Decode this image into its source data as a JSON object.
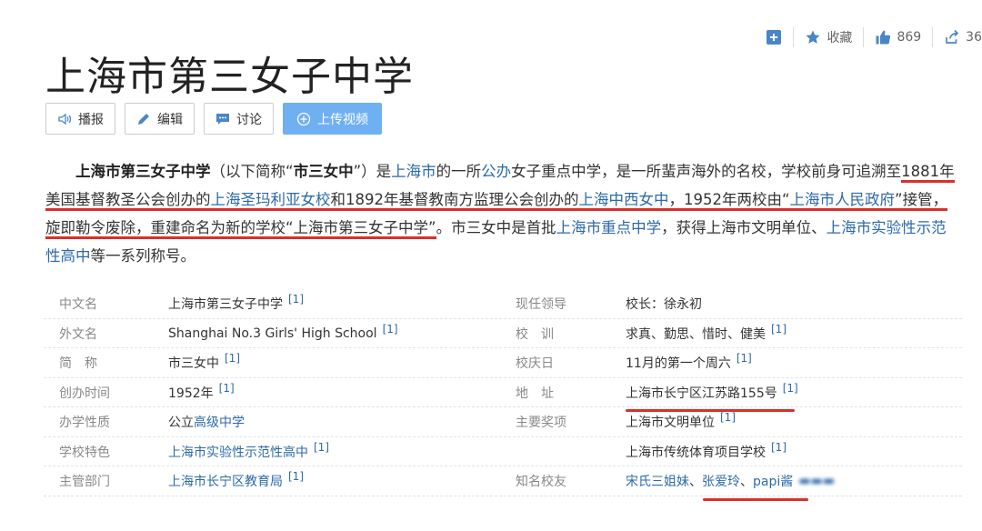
{
  "top_actions": {
    "add_icon": "plus-square-icon",
    "favorite_label": "收藏",
    "like_count": "869",
    "share_count": "36"
  },
  "title": "上海市第三女子中学",
  "toolbar": {
    "broadcast_label": "播报",
    "edit_label": "编辑",
    "discuss_label": "讨论",
    "upload_video_label": "上传视频"
  },
  "summary": {
    "bold_name": "上海市第三女子中学",
    "t1": "（以下简称“",
    "abbr": "市三女中",
    "t2": "”）是",
    "link_shanghai": "上海市",
    "t3": "的一所",
    "link_public": "公办",
    "t4": "女子重点中学，是一所蜚声海外的名校，学校前身可追溯至",
    "t5": "1881年美国基督教圣公会创办的",
    "link_school1": "上海圣玛利亚女校",
    "t6": "和1892年基督教南方监理公会创办的",
    "link_school2": "上海中西女中",
    "t7": "，1952年两校由“",
    "link_gov": "上海市人民政府",
    "t8": "”接管，旋即勒令废除，重建命名为新的学校“上海市第三女子中学”",
    "t9": "。市三女中是首批",
    "link_key": "上海市重点中学",
    "t10": "，获得上海市文明单位、",
    "link_exp": "上海市实验性示范性高中",
    "t11": "等一系列称号。"
  },
  "info_left": [
    {
      "label": "中文名",
      "value": "上海市第三女子中学",
      "link": false,
      "ref": "[1]"
    },
    {
      "label": "外文名",
      "value": "Shanghai No.3 Girls' High School",
      "link": false,
      "ref": "[1]"
    },
    {
      "label": "简　称",
      "value": "市三女中",
      "link": false,
      "ref": "[1]"
    },
    {
      "label": "创办时间",
      "value": "1952年",
      "link": false,
      "ref": "[1]"
    },
    {
      "label": "办学性质",
      "value_prefix": "公立",
      "value": "高级中学",
      "link": true,
      "ref": ""
    },
    {
      "label": "学校特色",
      "value": "上海市实验性示范性高中",
      "link": true,
      "ref": "[1]"
    },
    {
      "label": "主管部门",
      "value": "上海市长宁区教育局",
      "link": true,
      "ref": "[1]"
    }
  ],
  "info_right": [
    {
      "label": "现任领导",
      "value": "校长：徐永初",
      "ref": ""
    },
    {
      "label": "校　训",
      "value": "求真、勤思、惜时、健美",
      "ref": "[1]"
    },
    {
      "label": "校庆日",
      "value": "11月的第一个周六",
      "ref": "[1]"
    },
    {
      "label": "地　址",
      "value": "上海市长宁区江苏路155号",
      "ref": "[1]"
    },
    {
      "label": "主要奖项",
      "value": "上海市文明单位",
      "ref": "[1]"
    },
    {
      "label": "",
      "value": "上海市传统体育项目学校",
      "ref": "[1]"
    },
    {
      "label": "知名校友",
      "alumni": [
        "宋氏三姐妹",
        "张爱玲",
        "papi酱"
      ],
      "sep": "、"
    }
  ],
  "colors": {
    "link": "#2d6aa8",
    "primary_button": "#6fb0f3",
    "annotation_red": "#d9302a"
  }
}
